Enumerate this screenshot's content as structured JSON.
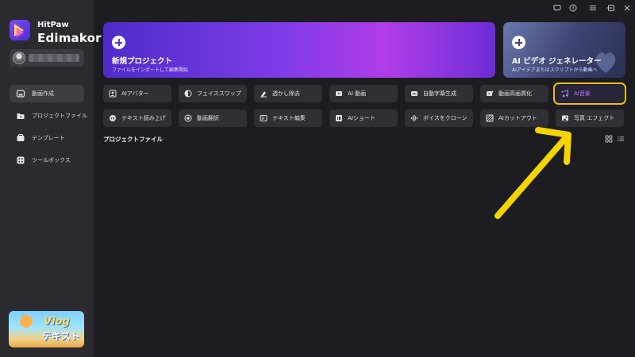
{
  "app": {
    "brand_line1": "HitPaw",
    "brand_line2": "Edimakor"
  },
  "sidebar": {
    "items": [
      {
        "label": "動画作成",
        "icon": "home-icon",
        "active": true
      },
      {
        "label": "プロジェクトファイル",
        "icon": "folder-icon",
        "active": false
      },
      {
        "label": "テンプレート",
        "icon": "template-icon",
        "active": false
      },
      {
        "label": "ツールボックス",
        "icon": "toolbox-icon",
        "active": false
      }
    ],
    "promo": {
      "title": "Vlog",
      "subtitle": "テキスト"
    }
  },
  "cards": {
    "new_project": {
      "title": "新規プロジェクト",
      "subtitle": "ファイルをインポートして編集開始"
    },
    "ai_video": {
      "title": "AI ビデオ ジェネレーター",
      "subtitle": "AIアイデアまたはスクリプトから動画へ"
    }
  },
  "tools": {
    "row1": [
      {
        "label": "AIアバター",
        "icon": "avatar-icon"
      },
      {
        "label": "フェイススワップ",
        "icon": "face-swap-icon"
      },
      {
        "label": "透かし除去",
        "icon": "watermark-remove-icon"
      },
      {
        "label": "AI 動画",
        "icon": "ai-video-icon"
      },
      {
        "label": "自動字幕生成",
        "icon": "cc-icon"
      },
      {
        "label": "動画高画質化",
        "icon": "enhance-icon"
      },
      {
        "label": "AI音楽",
        "icon": "music-icon"
      }
    ],
    "row2": [
      {
        "label": "テキスト読み上げ",
        "icon": "tts-icon"
      },
      {
        "label": "動画翻訳",
        "icon": "translate-icon"
      },
      {
        "label": "テキスト編集",
        "icon": "text-edit-icon"
      },
      {
        "label": "AIショート",
        "icon": "ai-short-icon"
      },
      {
        "label": "ボイスをクローン",
        "icon": "voice-clone-icon"
      },
      {
        "label": "AIカットアウト",
        "icon": "cutout-icon"
      },
      {
        "label": "写真 エフェクト",
        "icon": "photo-effect-icon"
      }
    ]
  },
  "main": {
    "section_title": "プロジェクトファイル"
  },
  "colors": {
    "accent": "#8a4dff",
    "highlight_box": "#f2c300",
    "annotation_arrow": "#f5d400"
  }
}
